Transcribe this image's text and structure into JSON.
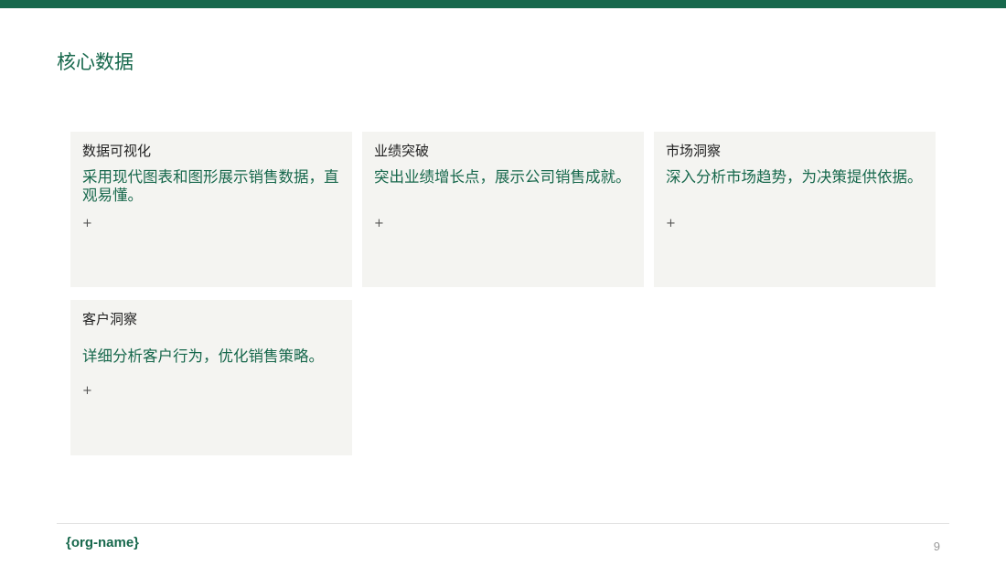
{
  "header": {
    "title": "核心数据"
  },
  "cards": [
    {
      "title": "数据可视化",
      "body": "采用现代图表和图形展示销售数据，直观易懂。",
      "plus": "+"
    },
    {
      "title": "业绩突破",
      "body": "突出业绩增长点，展示公司销售成就。",
      "plus": "+"
    },
    {
      "title": "市场洞察",
      "body": "深入分析市场趋势，为决策提供依据。",
      "plus": "+"
    },
    {
      "title": "客户洞察",
      "body": "详细分析客户行为，优化销售策略。",
      "plus": "+"
    }
  ],
  "footer": {
    "org_name": "{org-name}",
    "page_number": "9"
  },
  "colors": {
    "accent": "#17684c",
    "card_background": "#f4f4f1"
  }
}
